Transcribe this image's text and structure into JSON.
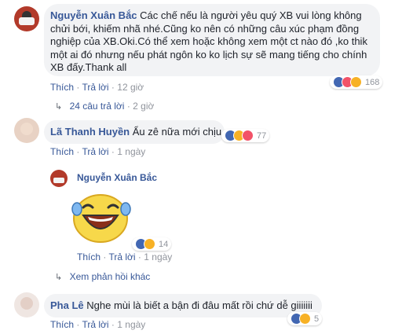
{
  "comments": [
    {
      "name": "Nguyễn Xuân Bắc",
      "text": "Các chế nếu là người yêu quý XB vui lòng không chửi bới, khiếm nhã nhé.Cũng ko nên có những câu xúc phạm đồng nghiệp của XB.Oki.Có thể xem hoặc không xem một ct nào đó ,ko thik một ai đó nhưng nếu phát ngôn ko ko lịch sự sẽ mang tiếng cho chính XB đấy.Thank all",
      "like_label": "Thích",
      "reply_label": "Trả lời",
      "time": "12 giờ",
      "reaction_count": "168",
      "replies_link": "24 câu trả lời",
      "replies_time": "2 giờ"
    },
    {
      "name": "Lã Thanh Huyền",
      "text": "Ẩu zê nữa mới chịu",
      "like_label": "Thích",
      "reply_label": "Trả lời",
      "time": "1 ngày",
      "reaction_count": "77"
    },
    {
      "name": "Nguyễn Xuân Bắc",
      "sticker": "laughing-sticker",
      "like_label": "Thích",
      "reply_label": "Trả lời",
      "time": "1 ngày",
      "reaction_count": "14",
      "more_replies": "Xem phản hồi khác"
    },
    {
      "name": "Pha Lê",
      "text": "Nghe mùi là biết a bận đi đâu mất rồi chứ dễ giiiiiii",
      "like_label": "Thích",
      "reply_label": "Trả lời",
      "time": "1 ngày",
      "reaction_count": "5"
    }
  ],
  "separator": "·",
  "colors": {
    "name": "#385898",
    "bubble": "#f2f3f5",
    "like": "#4267b2",
    "love": "#f25268",
    "haha": "#f7b125"
  }
}
